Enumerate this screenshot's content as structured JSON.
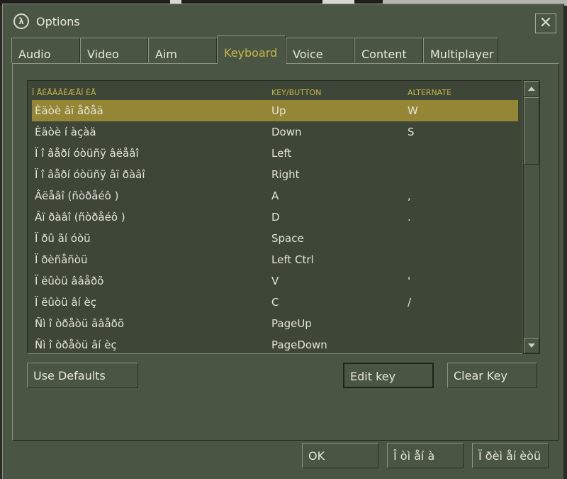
{
  "window": {
    "title": "Options",
    "close_glyph": "✕",
    "logo_icon": "half-life-lambda-logo"
  },
  "tabs": [
    {
      "label": "Audio",
      "active": false
    },
    {
      "label": "Video",
      "active": false
    },
    {
      "label": "Aim",
      "active": false
    },
    {
      "label": "Keyboard",
      "active": true
    },
    {
      "label": "Voice",
      "active": false
    },
    {
      "label": "Content",
      "active": false
    },
    {
      "label": "Multiplayer",
      "active": false
    }
  ],
  "keyboard": {
    "columns": {
      "action": "Ï ÅÉÅÄÂÈÆÅÍ ÈÅ",
      "key": "KEY/BUTTON",
      "alternate": "ALTERNATE"
    },
    "rows": [
      {
        "action": "Èäòè âï åðåä",
        "key": "Up",
        "alt": "W"
      },
      {
        "action": "Èäòè í àçàä",
        "key": "Down",
        "alt": "S"
      },
      {
        "action": "Ï î âåðí óòüñÿ âëåâî",
        "key": "Left",
        "alt": ""
      },
      {
        "action": "Ï î âåðí óòüñÿ âï ðàâî",
        "key": "Right",
        "alt": ""
      },
      {
        "action": "Âëåâî  (ñòðåéô )",
        "key": "A",
        "alt": ","
      },
      {
        "action": "Âï ðàâî  (ñòðåéô )",
        "key": "D",
        "alt": "."
      },
      {
        "action": "Ï ðû ãí óòü",
        "key": "Space",
        "alt": ""
      },
      {
        "action": "Ï ðèñåñòü",
        "key": "Left Ctrl",
        "alt": ""
      },
      {
        "action": "Ï ëûòü ââåðõ",
        "key": "V",
        "alt": "'"
      },
      {
        "action": "Ï ëûòü âí èç",
        "key": "C",
        "alt": "/"
      },
      {
        "action": "Ñì î òðåòü ââåðõ",
        "key": "PageUp",
        "alt": ""
      },
      {
        "action": "Ñì î òðåòü âí èç",
        "key": "PageDown",
        "alt": ""
      }
    ],
    "selected_index": 0
  },
  "buttons": {
    "use_defaults": "Use Defaults",
    "edit_key": "Edit key",
    "clear_key": "Clear Key",
    "ok": "OK",
    "cancel": "Î òì åí à",
    "apply": "Ï ðèì åí èòü"
  },
  "colors": {
    "panel": "#4b5543",
    "list_bg": "#3e4637",
    "accent": "#c4b549",
    "selection": "#958635"
  }
}
